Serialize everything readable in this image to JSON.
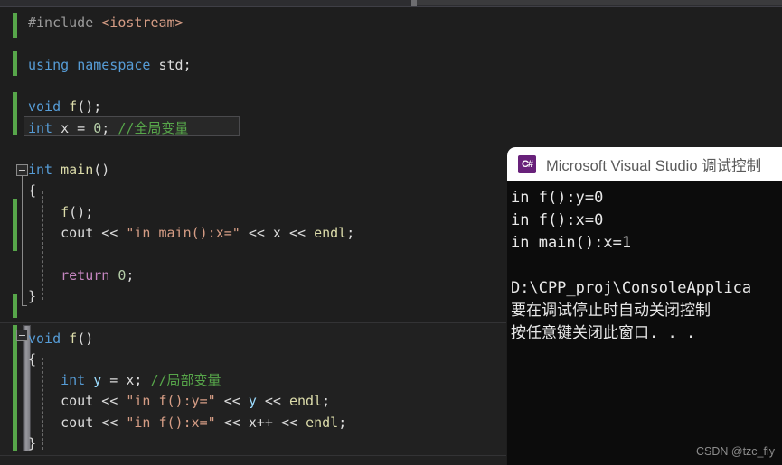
{
  "window": {
    "theme": "visual-studio-dark",
    "background_hex": "#1e1e1e",
    "accent_hex": "#68217a"
  },
  "editor": {
    "language": "cpp",
    "current_line_index": 4,
    "lines": [
      {
        "index": 0,
        "text": "#include <iostream>",
        "tokens": [
          {
            "t": "#include ",
            "c": "pre"
          },
          {
            "t": "<iostream>",
            "c": "inc"
          }
        ]
      },
      {
        "index": 1,
        "text": "",
        "tokens": []
      },
      {
        "index": 2,
        "text": "using namespace std;",
        "tokens": [
          {
            "t": "using",
            "c": "kw"
          },
          {
            "t": " ",
            "c": "plain"
          },
          {
            "t": "namespace",
            "c": "kw"
          },
          {
            "t": " std;",
            "c": "plain"
          }
        ]
      },
      {
        "index": 3,
        "text": "",
        "tokens": []
      },
      {
        "index": 4,
        "text": "void f();",
        "tokens": [
          {
            "t": "void",
            "c": "kw"
          },
          {
            "t": " ",
            "c": "plain"
          },
          {
            "t": "f",
            "c": "fn"
          },
          {
            "t": "();",
            "c": "plain"
          }
        ]
      },
      {
        "index": 5,
        "text": "int x = 0; //全局变量",
        "tokens": [
          {
            "t": "int",
            "c": "kw"
          },
          {
            "t": " x = ",
            "c": "plain"
          },
          {
            "t": "0",
            "c": "num"
          },
          {
            "t": "; ",
            "c": "plain"
          },
          {
            "t": "//全局变量",
            "c": "cmt"
          }
        ]
      },
      {
        "index": 6,
        "text": "",
        "tokens": []
      },
      {
        "index": 7,
        "text": "int main()",
        "tokens": [
          {
            "t": "int",
            "c": "kw"
          },
          {
            "t": " ",
            "c": "plain"
          },
          {
            "t": "main",
            "c": "fn"
          },
          {
            "t": "()",
            "c": "plain"
          }
        ]
      },
      {
        "index": 8,
        "text": "{",
        "tokens": [
          {
            "t": "{",
            "c": "plain"
          }
        ]
      },
      {
        "index": 9,
        "text": "    f();",
        "tokens": [
          {
            "t": "    ",
            "c": "plain"
          },
          {
            "t": "f",
            "c": "fn"
          },
          {
            "t": "();",
            "c": "plain"
          }
        ]
      },
      {
        "index": 10,
        "text": "    cout << \"in main():x=\" << x << endl;",
        "tokens": [
          {
            "t": "    cout << ",
            "c": "plain"
          },
          {
            "t": "\"in main():x=\"",
            "c": "str"
          },
          {
            "t": " << x << ",
            "c": "plain"
          },
          {
            "t": "endl",
            "c": "fn"
          },
          {
            "t": ";",
            "c": "plain"
          }
        ]
      },
      {
        "index": 11,
        "text": "",
        "tokens": []
      },
      {
        "index": 12,
        "text": "    return 0;",
        "tokens": [
          {
            "t": "    ",
            "c": "plain"
          },
          {
            "t": "return",
            "c": "kw2"
          },
          {
            "t": " ",
            "c": "plain"
          },
          {
            "t": "0",
            "c": "num"
          },
          {
            "t": ";",
            "c": "plain"
          }
        ]
      },
      {
        "index": 13,
        "text": "}",
        "tokens": [
          {
            "t": "}",
            "c": "plain"
          }
        ]
      },
      {
        "index": 14,
        "text": "",
        "tokens": []
      },
      {
        "index": 15,
        "text": "void f()",
        "tokens": [
          {
            "t": "void",
            "c": "kw"
          },
          {
            "t": " ",
            "c": "plain"
          },
          {
            "t": "f",
            "c": "fn"
          },
          {
            "t": "()",
            "c": "plain"
          }
        ]
      },
      {
        "index": 16,
        "text": "{",
        "tokens": [
          {
            "t": "{",
            "c": "plain"
          }
        ]
      },
      {
        "index": 17,
        "text": "    int y = x; //局部变量",
        "tokens": [
          {
            "t": "    ",
            "c": "plain"
          },
          {
            "t": "int",
            "c": "kw"
          },
          {
            "t": " ",
            "c": "plain"
          },
          {
            "t": "y",
            "c": "var"
          },
          {
            "t": " = x; ",
            "c": "plain"
          },
          {
            "t": "//局部变量",
            "c": "cmt"
          }
        ]
      },
      {
        "index": 18,
        "text": "    cout << \"in f():y=\" << y << endl;",
        "tokens": [
          {
            "t": "    cout << ",
            "c": "plain"
          },
          {
            "t": "\"in f():y=\"",
            "c": "str"
          },
          {
            "t": " << ",
            "c": "plain"
          },
          {
            "t": "y",
            "c": "var"
          },
          {
            "t": " << ",
            "c": "plain"
          },
          {
            "t": "endl",
            "c": "fn"
          },
          {
            "t": ";",
            "c": "plain"
          }
        ]
      },
      {
        "index": 19,
        "text": "    cout << \"in f():x=\" << x++ << endl;",
        "tokens": [
          {
            "t": "    cout << ",
            "c": "plain"
          },
          {
            "t": "\"in f():x=\"",
            "c": "str"
          },
          {
            "t": " << x++ << ",
            "c": "plain"
          },
          {
            "t": "endl",
            "c": "fn"
          },
          {
            "t": ";",
            "c": "plain"
          }
        ]
      },
      {
        "index": 20,
        "text": "}",
        "tokens": [
          {
            "t": "}",
            "c": "plain"
          }
        ]
      }
    ],
    "fold_labels": {
      "main": "collapse-main",
      "f": "collapse-f"
    }
  },
  "console": {
    "icon": "visual-studio-icon",
    "icon_glyph": "C#",
    "title": "Microsoft Visual Studio 调试控制",
    "output": [
      "in f():y=0",
      "in f():x=0",
      "in main():x=1",
      "",
      "D:\\CPP_proj\\ConsoleApplica",
      "要在调试停止时自动关闭控制",
      "按任意键关闭此窗口. . ."
    ]
  },
  "watermark": {
    "text": "CSDN @tzc_fly"
  }
}
